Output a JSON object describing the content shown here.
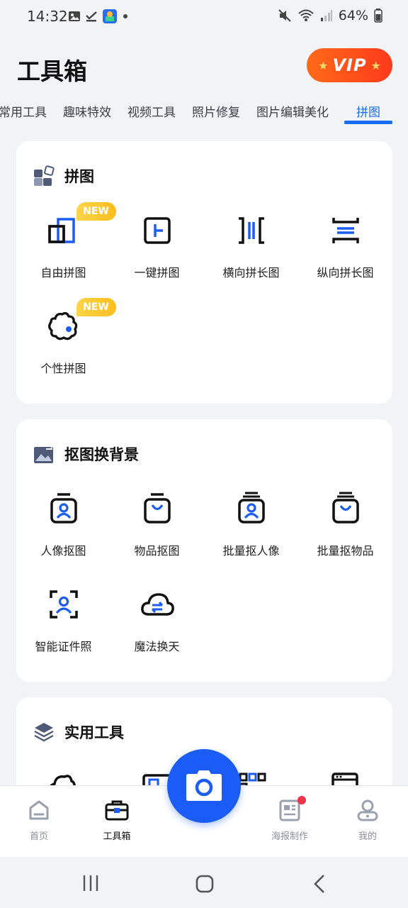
{
  "status_bar": {
    "time": "14:32",
    "battery": "64%"
  },
  "header": {
    "title": "工具箱",
    "vip_label": "VIP"
  },
  "tabs": [
    {
      "label": "常用工具"
    },
    {
      "label": "趣味特效"
    },
    {
      "label": "视频工具"
    },
    {
      "label": "照片修复"
    },
    {
      "label": "图片编辑美化"
    },
    {
      "label": "拼图",
      "active": true
    }
  ],
  "sections": [
    {
      "title": "拼图",
      "icon": "puzzle-icon",
      "tools": [
        {
          "label": "自由拼图",
          "icon": "free-collage-icon",
          "badge": "NEW"
        },
        {
          "label": "一键拼图",
          "icon": "one-click-collage-icon"
        },
        {
          "label": "横向拼长图",
          "icon": "horizontal-stitch-icon"
        },
        {
          "label": "纵向拼长图",
          "icon": "vertical-stitch-icon"
        },
        {
          "label": "个性拼图",
          "icon": "custom-puzzle-icon",
          "badge": "NEW"
        }
      ]
    },
    {
      "title": "抠图换背景",
      "icon": "image-swap-icon",
      "tools": [
        {
          "label": "人像抠图",
          "icon": "portrait-cutout-icon"
        },
        {
          "label": "物品抠图",
          "icon": "object-cutout-icon"
        },
        {
          "label": "批量抠人像",
          "icon": "batch-portrait-icon"
        },
        {
          "label": "批量抠物品",
          "icon": "batch-object-icon"
        },
        {
          "label": "智能证件照",
          "icon": "id-photo-icon"
        },
        {
          "label": "魔法换天",
          "icon": "sky-replace-icon"
        }
      ]
    },
    {
      "title": "实用工具",
      "icon": "layers-icon"
    }
  ],
  "bottom_nav": [
    {
      "label": "首页",
      "icon": "home-icon"
    },
    {
      "label": "工具箱",
      "icon": "toolbox-icon",
      "active": true
    },
    {
      "label": "海报制作",
      "icon": "poster-icon",
      "has_dot": true
    },
    {
      "label": "我的",
      "icon": "profile-icon"
    }
  ],
  "colors": {
    "accent": "#1a6cf0",
    "vip": "#ff4a1c",
    "badge_new": "#ffc52a",
    "fab": "#1a5cf5"
  }
}
